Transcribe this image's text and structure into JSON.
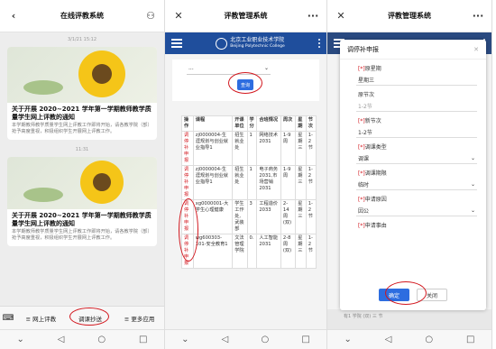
{
  "p1": {
    "title": "在线评教系统",
    "ts1": "3/1/21 15:12",
    "ts2": "11:31",
    "article_title": "关于开展 2020~2021 学年第一学期教师教学质量学生网上评教的通知",
    "article_desc": "本学期教师教学质量学生网上评教工作即将开始，请各教学院（部）抢予高度重视，积极组织学生开展网上评教工作。",
    "menu": [
      "≡ 网上评教",
      "调课抄送",
      "≡ 更多应用"
    ]
  },
  "p2": {
    "title": "评教管理系统",
    "logo_cn": "北京工业职业技术学院",
    "logo_en": "Beijing Polytechnic College",
    "select_value": "...",
    "query_label": "查询",
    "headers": [
      "操作",
      "课程",
      "开课单位",
      "学分",
      "合班情况",
      "周次",
      "星期",
      "节次"
    ],
    "rows": [
      [
        "调停补申报",
        "zj0000004-生涯规划与创业就业指导1",
        "招生就业处",
        "1",
        "网络技术2031",
        "1-9周",
        "星期三",
        "1-2节"
      ],
      [
        "调停补申报",
        "zj0000004-生涯规划与创业就业指导1",
        "招生就业处",
        "1",
        "电子商务2031,市场营销2031",
        "1-9周",
        "星期三",
        "1-2节"
      ],
      [
        "调停补申报",
        "xg0000001-大学生心理健康",
        "学生工作处,武装部",
        "3",
        "工程造价2033",
        "2-14周(双)",
        "星期三",
        "1-2节"
      ],
      [
        "调停补申报",
        "wg600303-101-安全教育1",
        "文法管理学院",
        "0.",
        "人工智能2031",
        "2-8周(双)",
        "星期三",
        "1-2节"
      ]
    ]
  },
  "p3": {
    "title": "评教管理系统",
    "modal_title": "调停补申报",
    "fields": [
      {
        "label": "原星期",
        "value": "星期三"
      },
      {
        "label": "原节次",
        "value": "1-2节"
      },
      {
        "label": "新节次",
        "value": "1-2节"
      },
      {
        "label": "调课类型",
        "value": "调课"
      },
      {
        "label": "调课期限",
        "value": "临时"
      },
      {
        "label": "申请原因",
        "value": "因公"
      },
      {
        "label": "申请事由",
        "value": ""
      }
    ],
    "ok_label": "确定",
    "close_label": "关闭",
    "bottom_row": "有1  学院  (双)  三  节"
  }
}
